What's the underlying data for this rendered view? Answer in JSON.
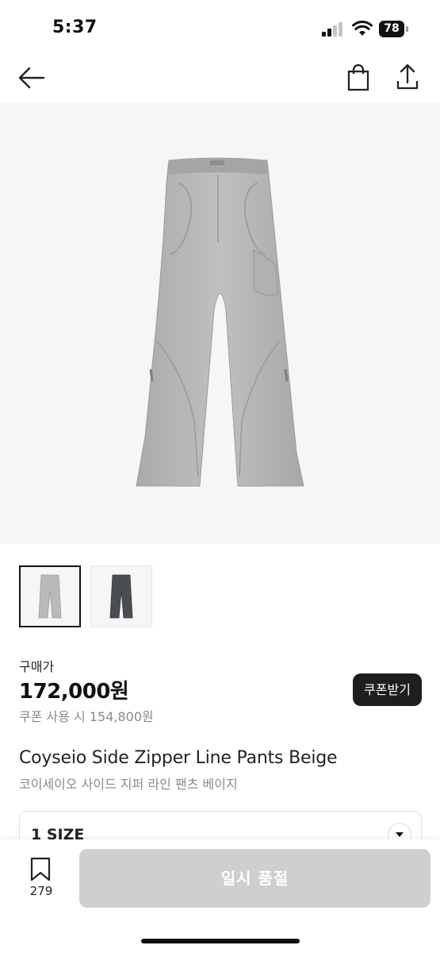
{
  "status": {
    "time": "5:37",
    "battery": "78"
  },
  "nav": {
    "back_icon": "arrow-left-icon",
    "bag_icon": "shopping-bag-icon",
    "share_icon": "share-icon"
  },
  "product": {
    "image_color": "#b7b9b7",
    "thumbnails": [
      {
        "color": "#b8bab8",
        "selected": true
      },
      {
        "color": "#4a4d52",
        "selected": false
      }
    ],
    "buy_label": "구매가",
    "price": "172,000원",
    "coupon_price": "쿠폰 사용 시 154,800원",
    "coupon_button": "쿠폰받기",
    "name_en": "Coyseio Side Zipper Line Pants Beige",
    "name_ko": "코이세이오 사이드 지퍼 라인 팬츠 베이지"
  },
  "size_select": {
    "value": "1 SIZE"
  },
  "bottom": {
    "bookmark_count": "279",
    "soldout_label": "일시 품절"
  },
  "colors": {
    "soldout_bg": "#cfcfcf",
    "coupon_bg": "#1e1e1e"
  }
}
